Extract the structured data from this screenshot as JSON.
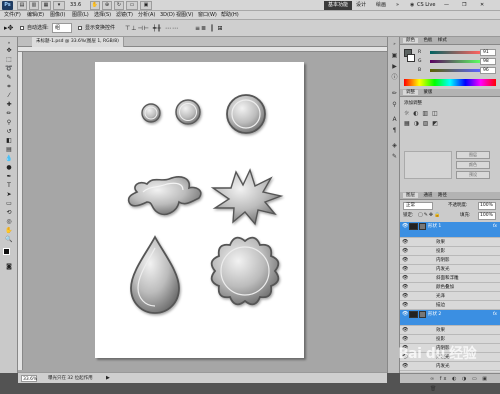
{
  "titlebar": {
    "logo": "Ps",
    "zoom": "33.6",
    "workspace_active": "基本功能",
    "workspace_design": "设计",
    "workspace_paint": "绘画",
    "cs_live": "CS Live"
  },
  "menubar": {
    "items": [
      "文件(F)",
      "编辑(E)",
      "图像(I)",
      "图层(L)",
      "选择(S)",
      "滤镜(T)",
      "分析(A)",
      "3D(D)",
      "视图(V)",
      "窗口(W)",
      "帮助(H)"
    ]
  },
  "options": {
    "auto_select": "自动选择:",
    "auto_select_value": "组",
    "show_transform": "显示变换控件"
  },
  "document": {
    "tab_title": "未标题-1.psd @ 33.6%(图层 1, RGB/8)",
    "status_zoom": "33.6%",
    "status_info": "曝光只在 32 位起作用"
  },
  "panels": {
    "color_tabs": [
      "颜色",
      "色板",
      "样式"
    ],
    "color_rows": [
      {
        "label": "R",
        "value": "91"
      },
      {
        "label": "G",
        "value": "98"
      },
      {
        "label": "B",
        "value": "96"
      }
    ],
    "adjust_tabs": [
      "调整",
      "蒙版"
    ],
    "adjust_title": "添加调整",
    "adjust_buttons": [
      "图层",
      "颜色",
      "预设"
    ],
    "layers_tabs": [
      "图层",
      "通道",
      "路径"
    ],
    "blend_mode": "正常",
    "opacity_label": "不透明度:",
    "opacity_value": "100%",
    "lock_label": "锁定:",
    "fill_label": "填充:",
    "fill_value": "100%",
    "layers": [
      {
        "name": "形状 1",
        "type": "layer",
        "selected": true
      },
      {
        "name": "效果",
        "type": "effect",
        "selected": false
      },
      {
        "name": "投影",
        "type": "effect",
        "selected": false
      },
      {
        "name": "内阴影",
        "type": "effect",
        "selected": false
      },
      {
        "name": "内发光",
        "type": "effect",
        "selected": false
      },
      {
        "name": "斜面和浮雕",
        "type": "effect",
        "selected": false
      },
      {
        "name": "颜色叠加",
        "type": "effect",
        "selected": false
      },
      {
        "name": "光泽",
        "type": "effect",
        "selected": false
      },
      {
        "name": "描边",
        "type": "effect",
        "selected": false
      },
      {
        "name": "形状 2",
        "type": "layer",
        "selected": true
      },
      {
        "name": "效果",
        "type": "effect",
        "selected": false
      },
      {
        "name": "投影",
        "type": "effect",
        "selected": false
      },
      {
        "name": "内阴影",
        "type": "effect",
        "selected": false
      },
      {
        "name": "外发光",
        "type": "effect",
        "selected": false
      },
      {
        "name": "内发光",
        "type": "effect",
        "selected": false
      },
      {
        "name": "颜色叠加",
        "type": "effect",
        "selected": false
      }
    ]
  },
  "watermark": "Bai du 经验"
}
